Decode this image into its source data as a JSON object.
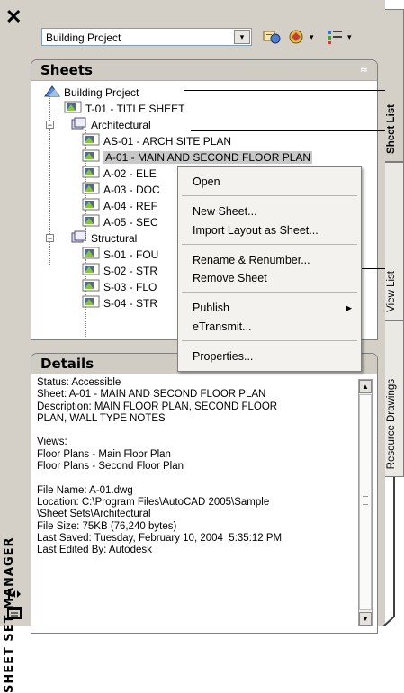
{
  "window": {
    "title": "SHEET SET MANAGER",
    "close_glyph": "✕"
  },
  "toolbar": {
    "sheet_set_selector": "Building Project",
    "dropdown_glyph": "▾",
    "icons": [
      "sheet-set-properties-icon",
      "publish-icon",
      "sheet-views-icon"
    ]
  },
  "sheets_panel": {
    "title": "Sheets",
    "collapse_glyph": "≈",
    "tree": [
      {
        "label": "Building Project",
        "level": 0,
        "kind": "set"
      },
      {
        "label": "T-01 - TITLE SHEET",
        "level": 1,
        "kind": "sheet"
      },
      {
        "label": "Architectural",
        "level": 1,
        "kind": "subset",
        "expander": "⊟"
      },
      {
        "label": "AS-01 - ARCH SITE PLAN",
        "level": 2,
        "kind": "sheet"
      },
      {
        "label": "A-01 - MAIN AND SECOND FLOOR PLAN",
        "level": 2,
        "kind": "sheet",
        "selected": true
      },
      {
        "label": "A-02 - ELE",
        "level": 2,
        "kind": "sheet"
      },
      {
        "label": "A-03 - DOC",
        "level": 2,
        "kind": "sheet"
      },
      {
        "label": "A-04 - REF",
        "level": 2,
        "kind": "sheet"
      },
      {
        "label": "A-05 - SEC",
        "level": 2,
        "kind": "sheet"
      },
      {
        "label": "Structural",
        "level": 1,
        "kind": "subset",
        "expander": "⊟"
      },
      {
        "label": "S-01 - FOU",
        "level": 2,
        "kind": "sheet"
      },
      {
        "label": "S-02 - STR",
        "level": 2,
        "kind": "sheet"
      },
      {
        "label": "S-03 - FLO",
        "level": 2,
        "kind": "sheet"
      },
      {
        "label": "S-04 - STR",
        "level": 2,
        "kind": "sheet"
      }
    ]
  },
  "context_menu": {
    "items": [
      "Open",
      "New Sheet...",
      "Import Layout as Sheet...",
      "Rename & Renumber...",
      "Remove Sheet",
      "Publish",
      "eTransmit...",
      "Properties..."
    ],
    "submenu_glyph": "▶"
  },
  "details_panel": {
    "title": "Details",
    "lines": [
      "Status: Accessible",
      "Sheet: A-01 - MAIN AND SECOND FLOOR PLAN",
      "Description: MAIN FLOOR PLAN, SECOND FLOOR",
      "PLAN, WALL TYPE NOTES",
      "",
      "Views:",
      "Floor Plans - Main Floor Plan",
      "Floor Plans - Second Floor Plan",
      "",
      "File Name: A-01.dwg",
      "Location: C:\\Program Files\\AutoCAD 2005\\Sample",
      "\\Sheet Sets\\Architectural",
      "File Size: 75KB (76,240 bytes)",
      "Last Saved: Tuesday, February 10, 2004  5:35:12 PM",
      "Last Edited By: Autodesk"
    ],
    "scroll_up_glyph": "▲",
    "scroll_down_glyph": "▼"
  },
  "tabs": [
    {
      "label": "Sheet List",
      "active": true
    },
    {
      "label": "View List",
      "active": false
    },
    {
      "label": "Resource Drawings",
      "active": false
    }
  ]
}
